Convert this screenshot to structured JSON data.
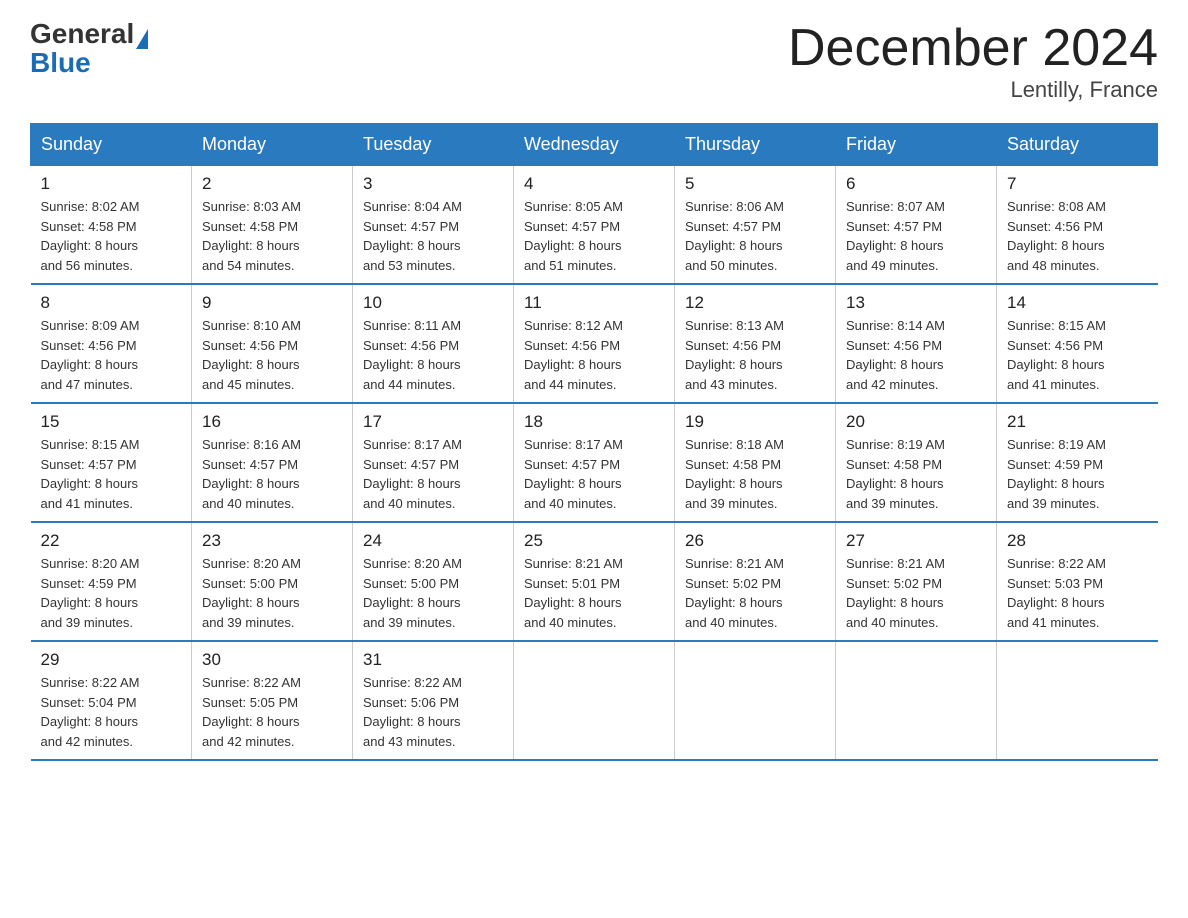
{
  "header": {
    "logo_general": "General",
    "logo_blue": "Blue",
    "title": "December 2024",
    "subtitle": "Lentilly, France"
  },
  "days_of_week": [
    "Sunday",
    "Monday",
    "Tuesday",
    "Wednesday",
    "Thursday",
    "Friday",
    "Saturday"
  ],
  "weeks": [
    [
      {
        "day": "1",
        "sunrise": "8:02 AM",
        "sunset": "4:58 PM",
        "daylight": "8 hours and 56 minutes."
      },
      {
        "day": "2",
        "sunrise": "8:03 AM",
        "sunset": "4:58 PM",
        "daylight": "8 hours and 54 minutes."
      },
      {
        "day": "3",
        "sunrise": "8:04 AM",
        "sunset": "4:57 PM",
        "daylight": "8 hours and 53 minutes."
      },
      {
        "day": "4",
        "sunrise": "8:05 AM",
        "sunset": "4:57 PM",
        "daylight": "8 hours and 51 minutes."
      },
      {
        "day": "5",
        "sunrise": "8:06 AM",
        "sunset": "4:57 PM",
        "daylight": "8 hours and 50 minutes."
      },
      {
        "day": "6",
        "sunrise": "8:07 AM",
        "sunset": "4:57 PM",
        "daylight": "8 hours and 49 minutes."
      },
      {
        "day": "7",
        "sunrise": "8:08 AM",
        "sunset": "4:56 PM",
        "daylight": "8 hours and 48 minutes."
      }
    ],
    [
      {
        "day": "8",
        "sunrise": "8:09 AM",
        "sunset": "4:56 PM",
        "daylight": "8 hours and 47 minutes."
      },
      {
        "day": "9",
        "sunrise": "8:10 AM",
        "sunset": "4:56 PM",
        "daylight": "8 hours and 45 minutes."
      },
      {
        "day": "10",
        "sunrise": "8:11 AM",
        "sunset": "4:56 PM",
        "daylight": "8 hours and 44 minutes."
      },
      {
        "day": "11",
        "sunrise": "8:12 AM",
        "sunset": "4:56 PM",
        "daylight": "8 hours and 44 minutes."
      },
      {
        "day": "12",
        "sunrise": "8:13 AM",
        "sunset": "4:56 PM",
        "daylight": "8 hours and 43 minutes."
      },
      {
        "day": "13",
        "sunrise": "8:14 AM",
        "sunset": "4:56 PM",
        "daylight": "8 hours and 42 minutes."
      },
      {
        "day": "14",
        "sunrise": "8:15 AM",
        "sunset": "4:56 PM",
        "daylight": "8 hours and 41 minutes."
      }
    ],
    [
      {
        "day": "15",
        "sunrise": "8:15 AM",
        "sunset": "4:57 PM",
        "daylight": "8 hours and 41 minutes."
      },
      {
        "day": "16",
        "sunrise": "8:16 AM",
        "sunset": "4:57 PM",
        "daylight": "8 hours and 40 minutes."
      },
      {
        "day": "17",
        "sunrise": "8:17 AM",
        "sunset": "4:57 PM",
        "daylight": "8 hours and 40 minutes."
      },
      {
        "day": "18",
        "sunrise": "8:17 AM",
        "sunset": "4:57 PM",
        "daylight": "8 hours and 40 minutes."
      },
      {
        "day": "19",
        "sunrise": "8:18 AM",
        "sunset": "4:58 PM",
        "daylight": "8 hours and 39 minutes."
      },
      {
        "day": "20",
        "sunrise": "8:19 AM",
        "sunset": "4:58 PM",
        "daylight": "8 hours and 39 minutes."
      },
      {
        "day": "21",
        "sunrise": "8:19 AM",
        "sunset": "4:59 PM",
        "daylight": "8 hours and 39 minutes."
      }
    ],
    [
      {
        "day": "22",
        "sunrise": "8:20 AM",
        "sunset": "4:59 PM",
        "daylight": "8 hours and 39 minutes."
      },
      {
        "day": "23",
        "sunrise": "8:20 AM",
        "sunset": "5:00 PM",
        "daylight": "8 hours and 39 minutes."
      },
      {
        "day": "24",
        "sunrise": "8:20 AM",
        "sunset": "5:00 PM",
        "daylight": "8 hours and 39 minutes."
      },
      {
        "day": "25",
        "sunrise": "8:21 AM",
        "sunset": "5:01 PM",
        "daylight": "8 hours and 40 minutes."
      },
      {
        "day": "26",
        "sunrise": "8:21 AM",
        "sunset": "5:02 PM",
        "daylight": "8 hours and 40 minutes."
      },
      {
        "day": "27",
        "sunrise": "8:21 AM",
        "sunset": "5:02 PM",
        "daylight": "8 hours and 40 minutes."
      },
      {
        "day": "28",
        "sunrise": "8:22 AM",
        "sunset": "5:03 PM",
        "daylight": "8 hours and 41 minutes."
      }
    ],
    [
      {
        "day": "29",
        "sunrise": "8:22 AM",
        "sunset": "5:04 PM",
        "daylight": "8 hours and 42 minutes."
      },
      {
        "day": "30",
        "sunrise": "8:22 AM",
        "sunset": "5:05 PM",
        "daylight": "8 hours and 42 minutes."
      },
      {
        "day": "31",
        "sunrise": "8:22 AM",
        "sunset": "5:06 PM",
        "daylight": "8 hours and 43 minutes."
      },
      null,
      null,
      null,
      null
    ]
  ],
  "labels": {
    "sunrise": "Sunrise:",
    "sunset": "Sunset:",
    "daylight": "Daylight:"
  }
}
